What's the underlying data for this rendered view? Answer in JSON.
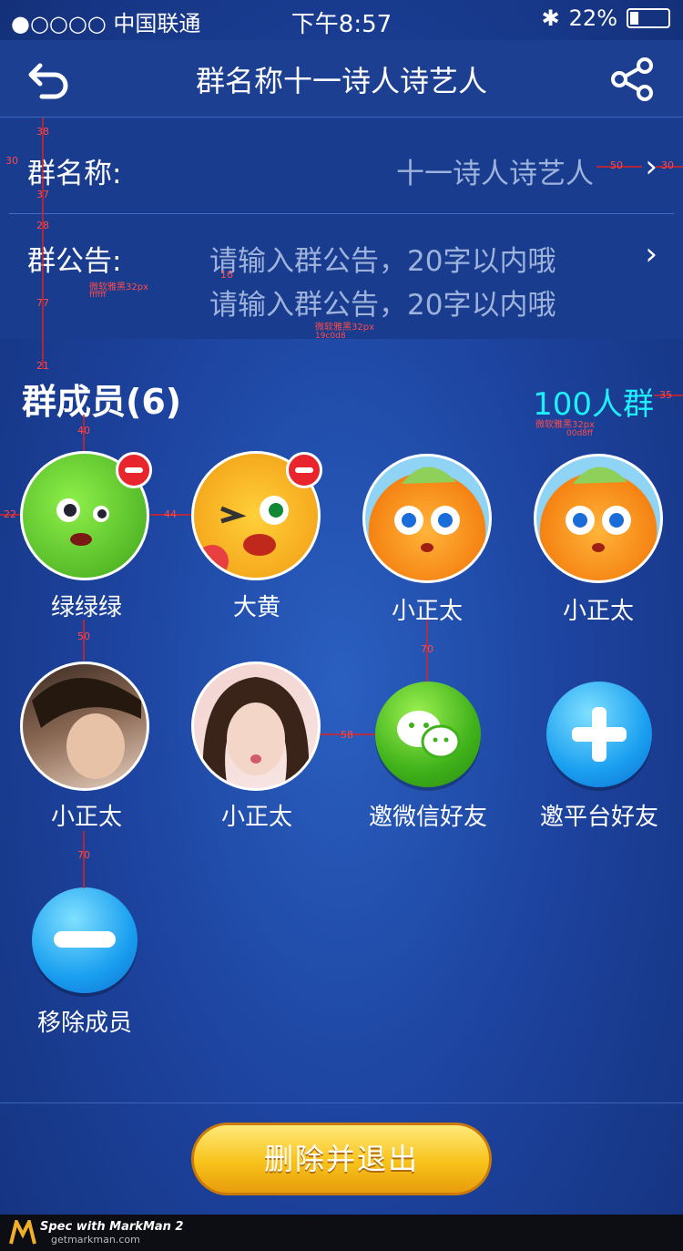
{
  "status_bar": {
    "carrier": "●○○○○ 中国联通",
    "time": "下午8:57",
    "battery": "22%"
  },
  "nav": {
    "title": "群名称十一诗人诗艺人"
  },
  "group_name": {
    "label": "群名称:",
    "value": "十一诗人诗艺人"
  },
  "announcement": {
    "label": "群公告:",
    "placeholder_line1": "请输入群公告，20字以内哦",
    "placeholder_line2": "请输入群公告，20字以内哦"
  },
  "members": {
    "title": "群成员(6)",
    "capacity": "100人群",
    "list": [
      {
        "name": "绿绿绿",
        "removable": true
      },
      {
        "name": "大黄",
        "removable": true
      },
      {
        "name": "小正太",
        "removable": false
      },
      {
        "name": "小正太",
        "removable": false
      },
      {
        "name": "小正太",
        "removable": false
      },
      {
        "name": "小正太",
        "removable": false
      }
    ],
    "invite_wechat": "邀微信好友",
    "invite_platform": "邀平台好友",
    "remove_member": "移除成员"
  },
  "quit_button": "删除并退出",
  "footer": {
    "brand": "Spec with MarkMan 2",
    "url": "getmarkman.com"
  },
  "annotations": {
    "font_note_1": "微软雅黑32px",
    "color_note_1": "ffffff",
    "font_note_2": "微软雅黑32px",
    "color_note_2": "19c0d8",
    "font_note_3": "微软雅黑32px",
    "color_note_3": "00d8ff",
    "m38": "38",
    "m30a": "30",
    "m37": "37",
    "m28": "28",
    "m16": "16",
    "m77": "77",
    "m21": "21",
    "m50a": "50",
    "m30b": "30",
    "m35": "35",
    "m40": "40",
    "m22": "22",
    "m44": "44",
    "m50b": "50",
    "m70a": "70",
    "m58": "58",
    "m70b": "70"
  },
  "colors": {
    "accent_cyan": "#1ff0ff",
    "quit_yellow": "#f8c21a",
    "remove_red": "#e8242c"
  }
}
